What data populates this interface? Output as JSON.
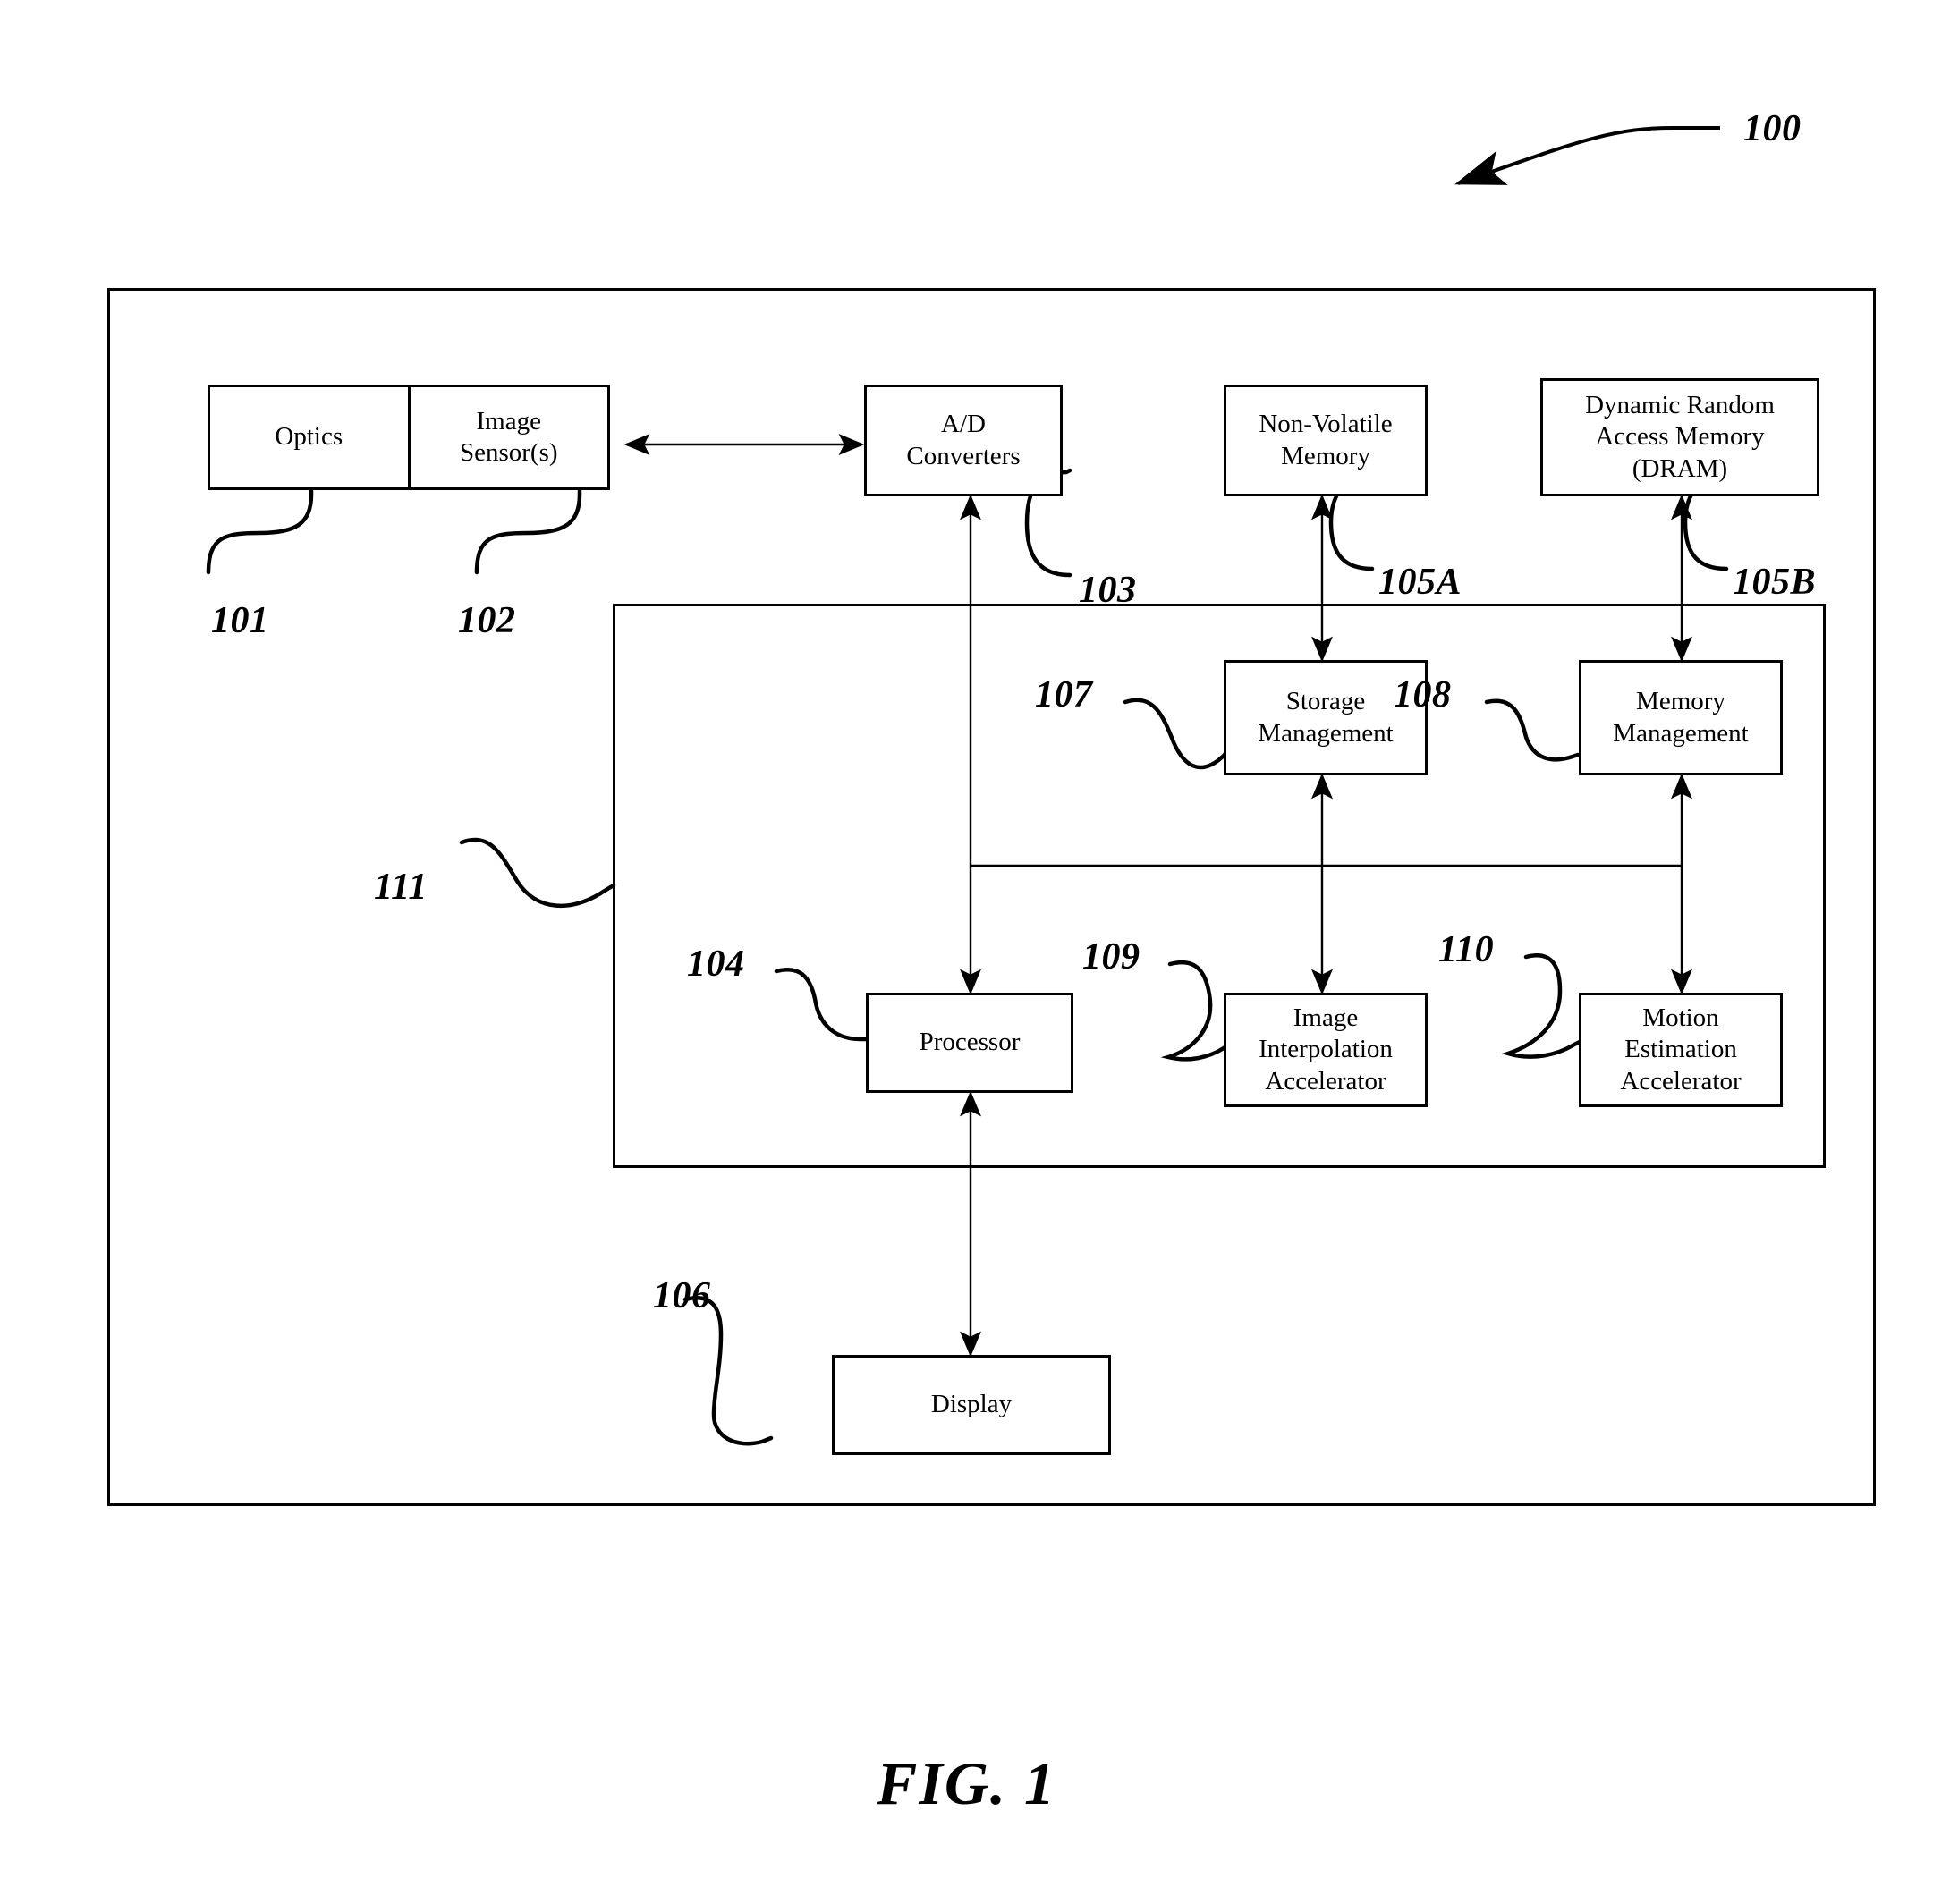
{
  "figure": {
    "caption": "FIG. 1",
    "system_ref": "100"
  },
  "nodes": {
    "optics": {
      "label": "Optics",
      "ref": "101"
    },
    "image_sensors": {
      "label": "Image\nSensor(s)",
      "ref": "102"
    },
    "ad_converters": {
      "label": "A/D\nConverters",
      "ref": "103"
    },
    "non_volatile_memory": {
      "label": "Non-Volatile\nMemory",
      "ref": "105A"
    },
    "dram": {
      "label": "Dynamic Random\nAccess Memory\n(DRAM)",
      "ref": "105B"
    },
    "storage_management": {
      "label": "Storage\nManagement",
      "ref": "107"
    },
    "memory_management": {
      "label": "Memory\nManagement",
      "ref": "108"
    },
    "processor": {
      "label": "Processor",
      "ref": "104"
    },
    "image_interpolation_accelerator": {
      "label": "Image\nInterpolation\nAccelerator",
      "ref": "109"
    },
    "motion_estimation_accelerator": {
      "label": "Motion\nEstimation\nAccelerator",
      "ref": "110"
    },
    "display": {
      "label": "Display",
      "ref": "106"
    },
    "soc": {
      "label": "",
      "ref": "111"
    }
  },
  "refs": {
    "r100": "100",
    "r101": "101",
    "r102": "102",
    "r103": "103",
    "r104": "104",
    "r105A": "105A",
    "r105B": "105B",
    "r106": "106",
    "r107": "107",
    "r108": "108",
    "r109": "109",
    "r110": "110",
    "r111": "111"
  },
  "colors": {
    "stroke": "#000000",
    "fill": "#ffffff",
    "background": "#ffffff"
  },
  "chart_data": {
    "type": "diagram",
    "title": "FIG. 1",
    "blocks": [
      "Optics",
      "Image Sensor(s)",
      "A/D Converters",
      "Non-Volatile Memory",
      "Dynamic Random Access Memory (DRAM)",
      "Storage Management",
      "Memory Management",
      "Processor",
      "Image Interpolation Accelerator",
      "Motion Estimation Accelerator",
      "Display"
    ],
    "connections": [
      {
        "from": "Image Sensor(s)",
        "to": "A/D Converters",
        "style": "double-arrow"
      },
      {
        "from": "A/D Converters",
        "to": "Processor",
        "style": "double-arrow"
      },
      {
        "from": "Non-Volatile Memory",
        "to": "Storage Management",
        "style": "double-arrow"
      },
      {
        "from": "Dynamic Random Access Memory (DRAM)",
        "to": "Memory Management",
        "style": "double-arrow"
      },
      {
        "from": "Storage Management",
        "to": "internal-bus",
        "style": "double-arrow"
      },
      {
        "from": "Memory Management",
        "to": "internal-bus",
        "style": "double-arrow"
      },
      {
        "from": "Processor",
        "to": "internal-bus",
        "style": "double-arrow"
      },
      {
        "from": "Image Interpolation Accelerator",
        "to": "internal-bus",
        "style": "double-arrow"
      },
      {
        "from": "Motion Estimation Accelerator",
        "to": "internal-bus",
        "style": "double-arrow"
      },
      {
        "from": "Processor",
        "to": "Display",
        "style": "double-arrow"
      }
    ]
  }
}
